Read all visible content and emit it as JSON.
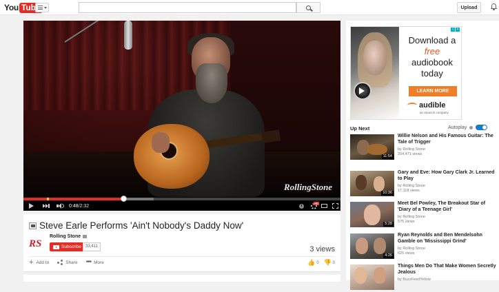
{
  "masthead": {
    "logo_you": "You",
    "logo_tube": "Tube",
    "search_placeholder": "",
    "upload_label": "Upload"
  },
  "player": {
    "watermark": "RollingStone",
    "current_time": "0:48",
    "time_separator": " / ",
    "duration": "2:32",
    "played_fraction": 0.316,
    "loaded_fraction": 0.41,
    "hd_badge": "HD"
  },
  "video": {
    "title": "Steve Earle Performs 'Ain't Nobody's Daddy Now'",
    "channel_logo": "RS",
    "channel_name": "Rolling Stone",
    "subscribe_label": "Subscribe",
    "subscriber_count": "33,411",
    "views": "3 views",
    "actions": {
      "add_to": "Add to",
      "share": "Share",
      "more": "More"
    },
    "likes": "0",
    "dislikes": "0"
  },
  "ad": {
    "headline_1": "Download a",
    "headline_free": "free",
    "headline_2": "audiobook",
    "headline_3": "today",
    "cta": "LEARN MORE",
    "brand": "audible",
    "brand_sub": "an amazon company"
  },
  "sidebar": {
    "up_next": "Up Next",
    "autoplay": "Autoplay",
    "autoplay_on": true,
    "videos": [
      {
        "title": "Willie Nelson and His Famous Guitar: The Tale of Trigger",
        "channel": "by Rolling Stone",
        "views": "204,471 views",
        "duration": "11:54"
      },
      {
        "title": "Gary and Eve: How Gary Clark Jr. Learned to Play",
        "channel": "by Rolling Stone",
        "views": "17,118 views",
        "duration": "10:36"
      },
      {
        "title": "Meet Bel Powley, The Breakout Star of 'Diary of a Teenage Girl'",
        "channel": "by Rolling Stone",
        "views": "575 views",
        "duration": "5:28"
      },
      {
        "title": "Ryan Reynolds and Ben Mendelsohn Gamble on 'Mississippi Grind'",
        "channel": "by Rolling Stone",
        "views": "625 views",
        "duration": "4:26"
      },
      {
        "title": "Things Men Do That Make Women Secretly Jealous",
        "channel": "by BuzzFeedYellow",
        "views": "",
        "duration": ""
      }
    ]
  },
  "colors": {
    "brand_red": "#e52d27",
    "accent_blue": "#167ac6",
    "audible_orange": "#f07e26"
  }
}
